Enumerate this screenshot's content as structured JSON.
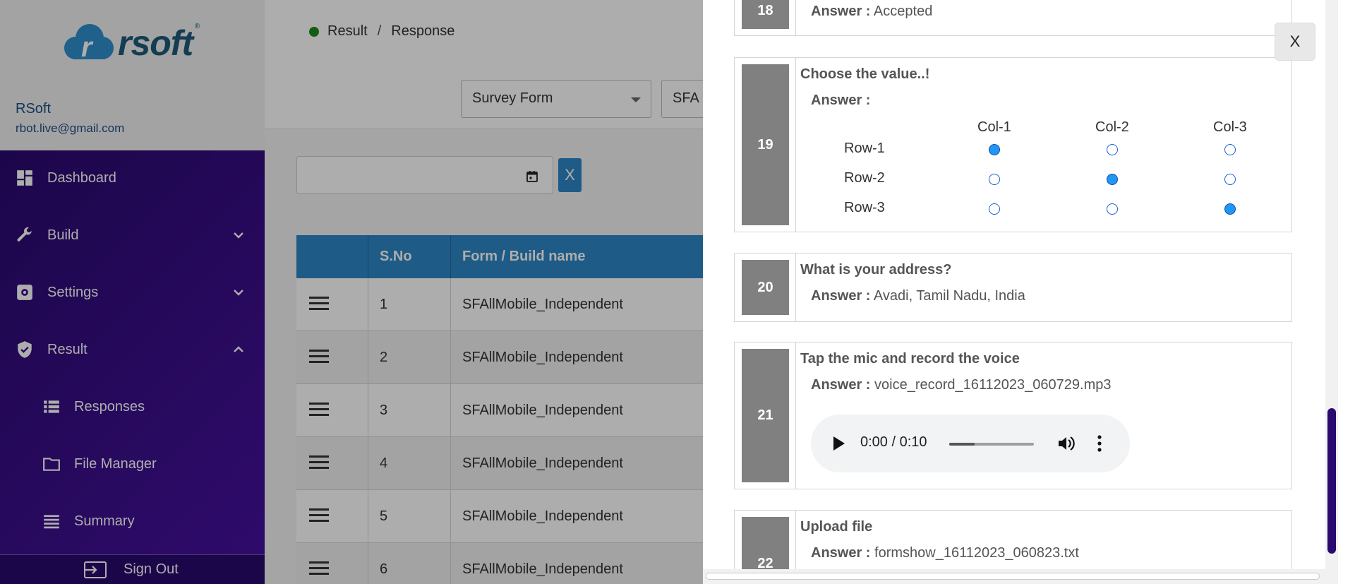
{
  "brand": {
    "logo_text": "rsoft",
    "logo_mark": "r",
    "registered": "®"
  },
  "user": {
    "name": "RSoft",
    "email": "rbot.live@gmail.com"
  },
  "nav": {
    "dashboard": "Dashboard",
    "build": "Build",
    "settings": "Settings",
    "result": "Result",
    "responses": "Responses",
    "file_manager": "File Manager",
    "summary": "Summary",
    "sign_out": "Sign Out"
  },
  "breadcrumb": {
    "root": "Result",
    "separator": "/",
    "current": "Response"
  },
  "filters": {
    "form_type": "Survey Form",
    "form_name": "SFA",
    "clear_label": "X"
  },
  "table": {
    "headers": [
      "",
      "S.No",
      "Form / Build name"
    ],
    "rows": [
      {
        "sno": "1",
        "name": "SFAllMobile_Independent"
      },
      {
        "sno": "2",
        "name": "SFAllMobile_Independent"
      },
      {
        "sno": "3",
        "name": "SFAllMobile_Independent"
      },
      {
        "sno": "4",
        "name": "SFAllMobile_Independent"
      },
      {
        "sno": "5",
        "name": "SFAllMobile_Independent"
      },
      {
        "sno": "6",
        "name": "SFAllMobile_Independent"
      }
    ]
  },
  "modal": {
    "close_label": "X",
    "answer_prefix": "Answer :",
    "q18": {
      "num": "18",
      "answer": "Accepted"
    },
    "q19": {
      "num": "19",
      "title": "Choose the value..!",
      "columns": [
        "Col-1",
        "Col-2",
        "Col-3"
      ],
      "rows": [
        "Row-1",
        "Row-2",
        "Row-3"
      ],
      "selected": [
        0,
        1,
        2
      ]
    },
    "q20": {
      "num": "20",
      "title": "What is your address?",
      "answer": "Avadi, Tamil Nadu, India"
    },
    "q21": {
      "num": "21",
      "title": "Tap the mic and record the voice",
      "answer": "voice_record_16112023_060729.mp3",
      "audio_time": "0:00 / 0:10",
      "audio_progress": 0.3
    },
    "q22": {
      "num": "22",
      "title": "Upload file",
      "answer": "formshow_16112023_060823.txt"
    }
  },
  "colors": {
    "sidebar": "#3b0a8f",
    "accent": "#2e86c8",
    "radio_selected": "#2196f3",
    "status_dot": "#1b8a1b"
  },
  "icons": [
    "dashboard-icon",
    "wrench-icon",
    "gear-icon",
    "shield-icon",
    "list-icon",
    "folder-icon",
    "menu-icon",
    "calendar-icon",
    "sign-out-icon",
    "play-icon",
    "volume-icon",
    "more-vert-icon"
  ]
}
